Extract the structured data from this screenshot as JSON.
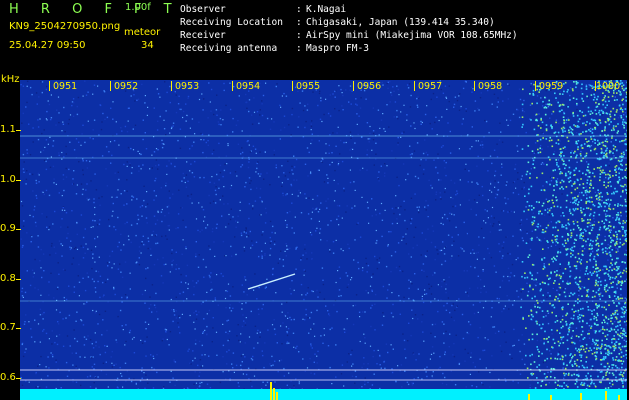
{
  "header": {
    "brand": "H R O F F T",
    "version": "1.00f",
    "filename": "KN9_2504270950.png",
    "mode": "meteor",
    "datetime": "25.04.27 09:50",
    "count": "34"
  },
  "info": [
    {
      "key": "Observer",
      "value": "K.Nagai"
    },
    {
      "key": "Receiving Location",
      "value": "Chigasaki, Japan (139.414 35.340)"
    },
    {
      "key": "Receiver",
      "value": "AirSpy mini (Miakejima VOR 108.65MHz)"
    },
    {
      "key": "Receiving antenna",
      "value": "Maspro FM-3"
    }
  ],
  "plot": {
    "unit_label": "kHz",
    "y_labels": [
      "1.1",
      "1.0",
      "0.9",
      "0.8",
      "0.7",
      "0.6"
    ],
    "time_labels": [
      "0951",
      "0952",
      "0953",
      "0954",
      "0955",
      "0956",
      "0957",
      "0958",
      "0959",
      "1000"
    ]
  },
  "colors": {
    "background": "#000000",
    "label_yellow": "#fff200",
    "brand_green": "#8dff52",
    "spectrogram_blue": "#0c2fa6",
    "baseline_cyan": "#00f0ff"
  }
}
